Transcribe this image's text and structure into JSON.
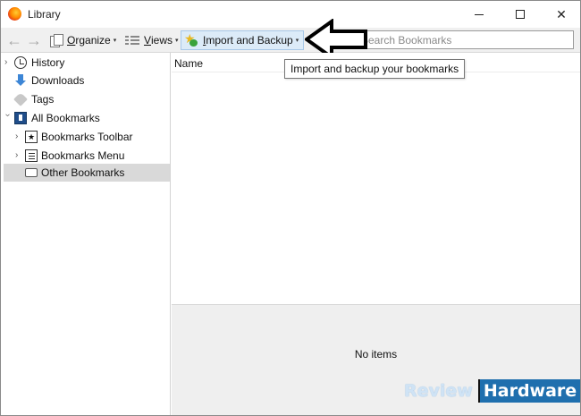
{
  "window": {
    "title": "Library",
    "app_icon": "firefox-icon",
    "controls": {
      "minimize": "minimize-icon",
      "maximize": "maximize-icon",
      "close": "✕"
    }
  },
  "toolbar": {
    "back_icon": "←",
    "forward_icon": "→",
    "organize": {
      "accel": "O",
      "rest": "rganize",
      "icon": "organize-icon"
    },
    "views": {
      "accel": "V",
      "rest": "iews",
      "icon": "views-icon"
    },
    "import_backup": {
      "accel": "I",
      "rest": "mport and Backup",
      "icon": "import-backup-icon"
    },
    "dropdown_caret": "▾",
    "search": {
      "placeholder": "Search Bookmarks",
      "value": ""
    }
  },
  "tooltip": {
    "text": "Import and backup your bookmarks"
  },
  "sidebar": {
    "items": [
      {
        "label": "History",
        "icon": "history-icon",
        "expandable": true,
        "expanded": false
      },
      {
        "label": "Downloads",
        "icon": "downloads-icon",
        "expandable": false
      },
      {
        "label": "Tags",
        "icon": "tags-icon",
        "expandable": false
      },
      {
        "label": "All Bookmarks",
        "icon": "all-bookmarks-icon",
        "expandable": true,
        "expanded": true
      },
      {
        "label": "Bookmarks Toolbar",
        "icon": "bookmarks-toolbar-icon",
        "expandable": true,
        "expanded": false
      },
      {
        "label": "Bookmarks Menu",
        "icon": "bookmarks-menu-icon",
        "expandable": true,
        "expanded": false
      },
      {
        "label": "Other Bookmarks",
        "icon": "other-bookmarks-icon",
        "expandable": false,
        "selected": true
      }
    ]
  },
  "content": {
    "columns": [
      "Name"
    ]
  },
  "details": {
    "empty_text": "No items"
  },
  "watermark": {
    "part1": "Review",
    "part2": "Hardware"
  },
  "colors": {
    "selected_row": "#d9d9d9",
    "import_button_bg": "#dcebf8",
    "watermark_blue": "#1f6fae"
  }
}
